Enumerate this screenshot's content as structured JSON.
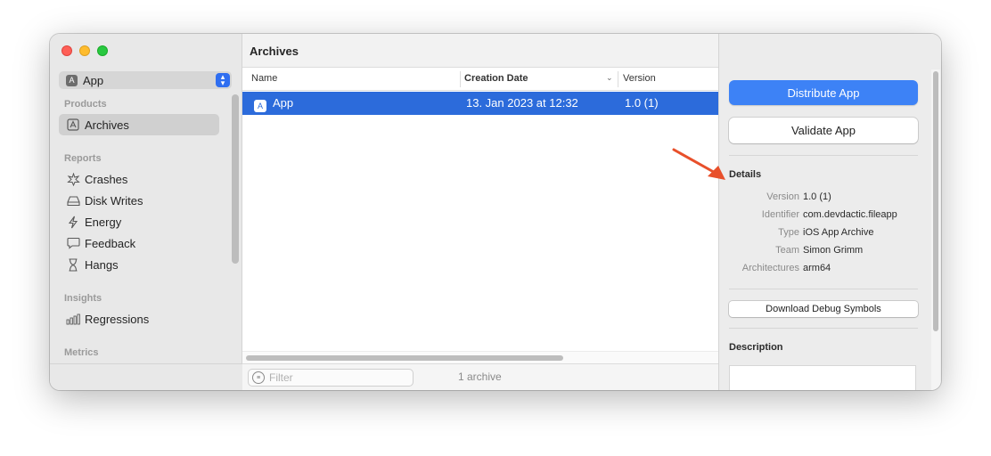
{
  "sidebar": {
    "app_selector": "App",
    "sections": [
      {
        "heading": "Products",
        "items": [
          {
            "label": "Archives",
            "icon": "archive-icon",
            "selected": true
          }
        ]
      },
      {
        "heading": "Reports",
        "items": [
          {
            "label": "Crashes",
            "icon": "crash-burst-icon"
          },
          {
            "label": "Disk Writes",
            "icon": "disk-icon"
          },
          {
            "label": "Energy",
            "icon": "lightning-bolt-icon"
          },
          {
            "label": "Feedback",
            "icon": "speech-bubble-icon"
          },
          {
            "label": "Hangs",
            "icon": "hourglass-icon"
          }
        ]
      },
      {
        "heading": "Insights",
        "items": [
          {
            "label": "Regressions",
            "icon": "bar-chart-icon"
          }
        ]
      },
      {
        "heading": "Metrics",
        "items": []
      }
    ]
  },
  "archives": {
    "title": "Archives",
    "columns": {
      "name": "Name",
      "creation_date": "Creation Date",
      "version": "Version"
    },
    "rows": [
      {
        "name": "App",
        "creation_date": "13. Jan 2023 at 12:32",
        "version": "1.0 (1)"
      }
    ],
    "filter_placeholder": "Filter",
    "count": "1 archive"
  },
  "inspector": {
    "distribute_label": "Distribute App",
    "validate_label": "Validate App",
    "details_heading": "Details",
    "details": [
      {
        "label": "Version",
        "value": "1.0 (1)"
      },
      {
        "label": "Identifier",
        "value": "com.devdactic.fileapp"
      },
      {
        "label": "Type",
        "value": "iOS App Archive"
      },
      {
        "label": "Team",
        "value": "Simon Grimm"
      },
      {
        "label": "Architectures",
        "value": "arm64"
      }
    ],
    "download_symbols_label": "Download Debug Symbols",
    "description_heading": "Description"
  },
  "colors": {
    "accent": "#2c6bdb",
    "primary_button": "#3d82f6",
    "annotation_arrow": "#e8502b"
  }
}
